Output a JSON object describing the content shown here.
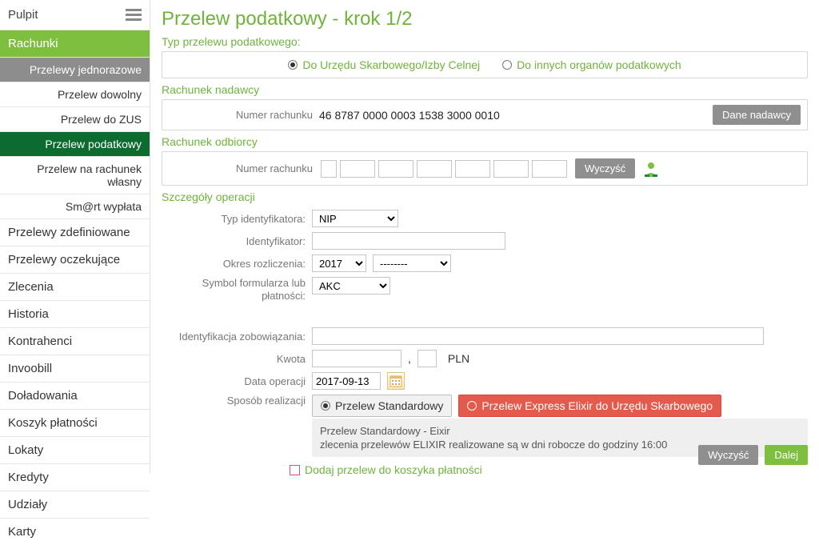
{
  "sidebar": {
    "top": "Pulpit",
    "items": [
      {
        "label": "Rachunki"
      },
      {
        "label": "Przelewy jednorazowe"
      },
      {
        "label": "Przelew dowolny"
      },
      {
        "label": "Przelew do ZUS"
      },
      {
        "label": "Przelew podatkowy"
      },
      {
        "label": "Przelew na rachunek własny"
      },
      {
        "label": "Sm@rt wypłata"
      },
      {
        "label": "Przelewy zdefiniowane"
      },
      {
        "label": "Przelewy oczekujące"
      },
      {
        "label": "Zlecenia"
      },
      {
        "label": "Historia"
      },
      {
        "label": "Kontrahenci"
      },
      {
        "label": "Invoobill"
      },
      {
        "label": "Doładowania"
      },
      {
        "label": "Koszyk płatności"
      },
      {
        "label": "Lokaty"
      },
      {
        "label": "Kredyty"
      },
      {
        "label": "Udziały"
      },
      {
        "label": "Karty"
      }
    ]
  },
  "page": {
    "title": "Przelew podatkowy - krok 1/2"
  },
  "transfer_type": {
    "section": "Typ przelewu podatkowego:",
    "option1": "Do Urzędu Skarbowego/Izby Celnej",
    "option2": "Do innych organów podatkowych",
    "selected": "option1"
  },
  "sender": {
    "section": "Rachunek nadawcy",
    "label": "Numer rachunku",
    "account": "46 8787 0000 0003 1538 3000 0010",
    "btn": "Dane nadawcy"
  },
  "receiver": {
    "section": "Rachunek odbiorcy",
    "label": "Numer rachunku",
    "clear_btn": "Wyczyść"
  },
  "details": {
    "section": "Szczegóły operacji",
    "id_type_label": "Typ identyfikatora:",
    "id_type_value": "NIP",
    "identifier_label": "Identyfikator:",
    "period_label": "Okres rozliczenia:",
    "period_year": "2017",
    "period_month": "--------",
    "form_symbol_label": "Symbol formularza lub płatności:",
    "form_symbol_value": "AKC",
    "obligation_label": "Identyfikacja zobowiązania:",
    "amount_label": "Kwota",
    "amount_separator": ",",
    "currency": "PLN",
    "date_label": "Data operacji",
    "date_value": "2017-09-13",
    "method_label": "Sposób realizacji",
    "method_standard": "Przelew Standardowy",
    "method_express": "Przelew Express Elixir do Urzędu Skarbowego",
    "info_line1": "Przelew Standardowy - Eixir",
    "info_line2": "zlecenia przelewów ELIXIR realizowane są w dni robocze do godziny 16:00",
    "basket_label": "Dodaj przelew do koszyka płatności"
  },
  "bottom": {
    "clear": "Wyczyść",
    "next": "Dalej"
  }
}
